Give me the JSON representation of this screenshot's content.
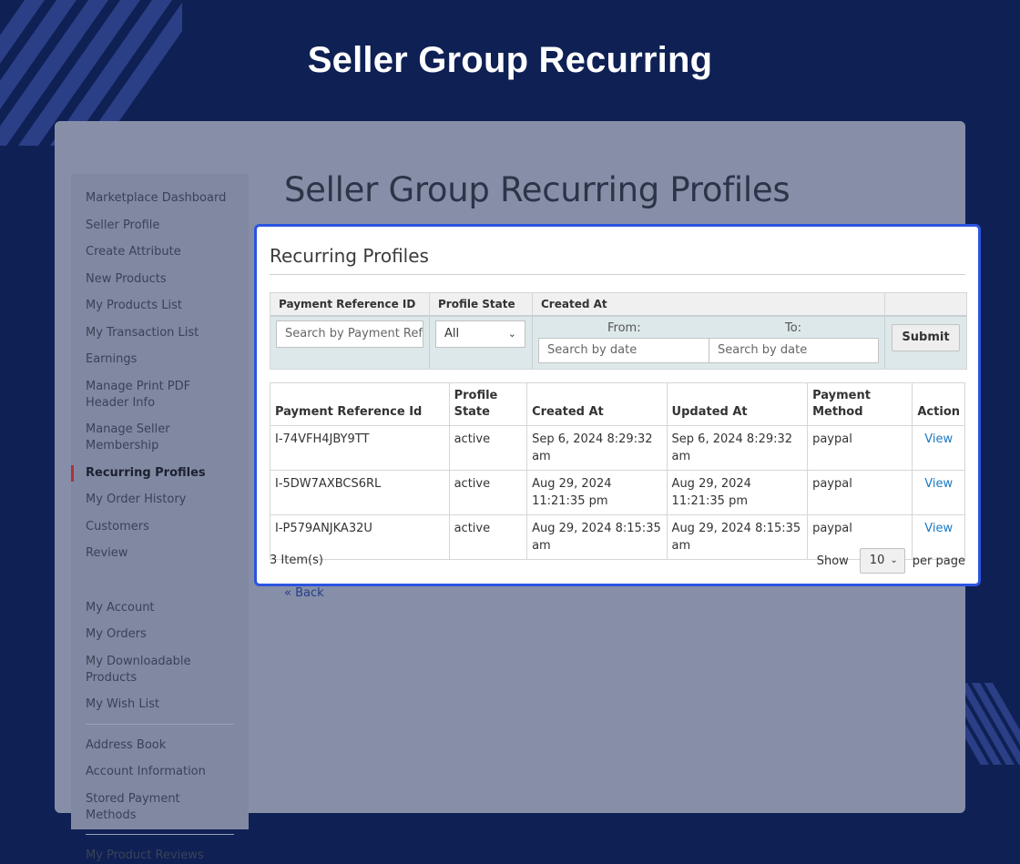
{
  "hero": {
    "title": "Seller Group Recurring"
  },
  "page": {
    "heading": "Seller Group Recurring Profiles",
    "back_label": "« Back"
  },
  "sidebar": {
    "group1": [
      "Marketplace Dashboard",
      "Seller Profile",
      "Create Attribute",
      "New Products",
      "My Products List",
      "My Transaction List",
      "Earnings",
      "Manage Print PDF Header Info",
      "Manage Seller Membership",
      "Recurring Profiles",
      "My Order History",
      "Customers",
      "Review"
    ],
    "active": "Recurring Profiles",
    "group2": [
      "My Account",
      "My Orders",
      "My Downloadable Products",
      "My Wish List"
    ],
    "group3": [
      "Address Book",
      "Account Information",
      "Stored Payment Methods"
    ],
    "group4": [
      "My Product Reviews"
    ]
  },
  "card": {
    "title": "Recurring Profiles",
    "filter": {
      "headers": [
        "Payment Reference ID",
        "Profile State",
        "Created At",
        ""
      ],
      "payment_ref_placeholder": "Search by Payment Reference ID",
      "state_value": "All",
      "from_label": "From:",
      "to_label": "To:",
      "date_placeholder": "Search by date",
      "submit_label": "Submit"
    },
    "table": {
      "columns": [
        "Payment Reference Id",
        "Profile State",
        "Created At",
        "Updated At",
        "Payment Method",
        "Action"
      ],
      "rows": [
        [
          "I-74VFH4JBY9TT",
          "active",
          "Sep 6, 2024 8:29:32 am",
          "Sep 6, 2024 8:29:32 am",
          "paypal",
          "View"
        ],
        [
          "I-5DW7AXBCS6RL",
          "active",
          "Aug 29, 2024 11:21:35 pm",
          "Aug 29, 2024 11:21:35 pm",
          "paypal",
          "View"
        ],
        [
          "I-P579ANJKA32U",
          "active",
          "Aug 29, 2024 8:15:35 am",
          "Aug 29, 2024 8:15:35 am",
          "paypal",
          "View"
        ]
      ]
    },
    "items_count": "3 Item(s)",
    "pager": {
      "show_label": "Show",
      "per_page_value": "10",
      "per_page_label": "per page"
    }
  },
  "colors": {
    "background": "#0f2054",
    "highlight_border": "#2b54e0",
    "link": "#1979c3"
  }
}
